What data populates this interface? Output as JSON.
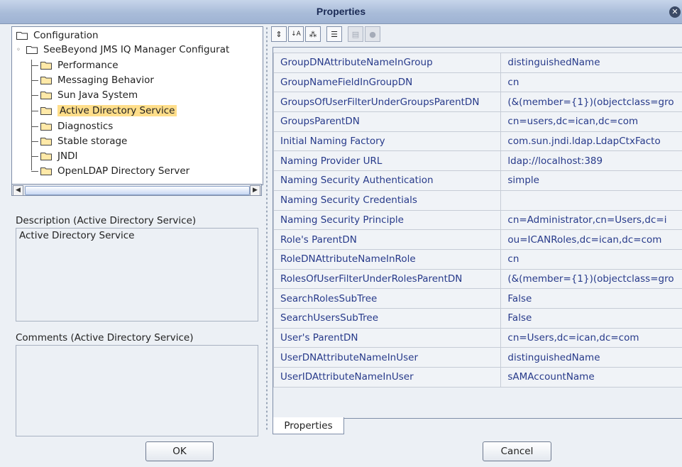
{
  "window": {
    "title": "Properties"
  },
  "tree": {
    "root_label": "Configuration",
    "child_label": "SeeBeyond JMS IQ Manager Configurat",
    "items": [
      {
        "label": "Performance",
        "selected": false
      },
      {
        "label": "Messaging Behavior",
        "selected": false
      },
      {
        "label": "Sun Java System",
        "selected": false
      },
      {
        "label": "Active Directory Service",
        "selected": true
      },
      {
        "label": "Diagnostics",
        "selected": false
      },
      {
        "label": "Stable storage",
        "selected": false
      },
      {
        "label": "JNDI",
        "selected": false
      },
      {
        "label": "OpenLDAP Directory Server",
        "selected": false
      }
    ]
  },
  "description": {
    "label": "Description (Active Directory Service)",
    "text": "Active Directory Service"
  },
  "comments": {
    "label": "Comments (Active Directory Service)",
    "text": ""
  },
  "toolbar": {
    "icons": [
      "collapse-icon",
      "sort-az-icon",
      "filter-icon",
      "checklist-icon",
      "panel-icon",
      "info-icon"
    ]
  },
  "properties": [
    {
      "name": "GroupDNAttributeNameInGroup",
      "value": "distinguishedName"
    },
    {
      "name": "GroupNameFieldInGroupDN",
      "value": "cn"
    },
    {
      "name": "GroupsOfUserFilterUnderGroupsParentDN",
      "value": "(&(member={1})(objectclass=gro"
    },
    {
      "name": "GroupsParentDN",
      "value": "cn=users,dc=ican,dc=com"
    },
    {
      "name": "Initial Naming Factory",
      "value": "com.sun.jndi.ldap.LdapCtxFacto"
    },
    {
      "name": "Naming Provider URL",
      "value": "ldap://localhost:389"
    },
    {
      "name": "Naming Security Authentication",
      "value": "simple"
    },
    {
      "name": "Naming Security Credentials",
      "value": ""
    },
    {
      "name": "Naming Security Principle",
      "value": "cn=Administrator,cn=Users,dc=i"
    },
    {
      "name": "Role's ParentDN",
      "value": "ou=ICANRoles,dc=ican,dc=com"
    },
    {
      "name": "RoleDNAttributeNameInRole",
      "value": "cn"
    },
    {
      "name": "RolesOfUserFilterUnderRolesParentDN",
      "value": "(&(member={1})(objectclass=gro"
    },
    {
      "name": "SearchRolesSubTree",
      "value": "False"
    },
    {
      "name": "SearchUsersSubTree",
      "value": "False"
    },
    {
      "name": "User's ParentDN",
      "value": "cn=Users,dc=ican,dc=com"
    },
    {
      "name": "UserDNAttributeNameInUser",
      "value": "distinguishedName"
    },
    {
      "name": "UserIDAttributeNameInUser",
      "value": "sAMAccountName"
    }
  ],
  "tab": {
    "label": "Properties"
  },
  "buttons": {
    "ok": "OK",
    "cancel": "Cancel"
  },
  "colors": {
    "selection": "#ffde8a",
    "property_text": "#273a8a",
    "titlebar": "#a9bcd9"
  }
}
